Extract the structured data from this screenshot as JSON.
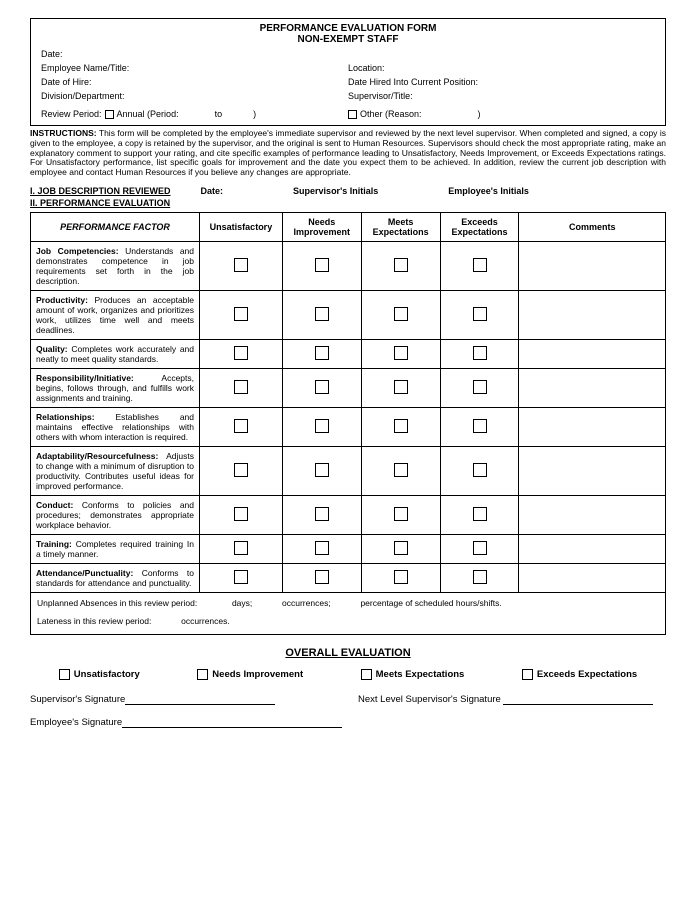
{
  "title1": "PERFORMANCE EVALUATION FORM",
  "title2": "NON-EXEMPT STAFF",
  "header": {
    "date": "Date:",
    "empName": "Employee Name/Title:",
    "location": "Location:",
    "dateHire": "Date of Hire:",
    "dateHiredPos": "Date Hired Into Current Position:",
    "division": "Division/Department:",
    "supervisor": "Supervisor/Title:",
    "reviewPeriod": "Review Period:",
    "annual": "Annual (Period:",
    "to": "to",
    "paren": ")",
    "other": "Other (Reason:"
  },
  "instrLabel": "INSTRUCTIONS:",
  "instrText": "This form will be completed by the employee's immediate supervisor and reviewed by the next level supervisor. When completed and signed, a copy is given to the employee, a copy is retained by the supervisor, and the original is sent to Human Resources. Supervisors should check the most appropriate rating, make an explanatory comment to support your rating, and cite specific examples of performance leading to Unsatisfactory, Needs Improvement, or Exceeds Expectations ratings. For Unsatisfactory performance, list specific goals for improvement and the date you expect them to be achieved. In addition, review the current job description with employee and contact Human Resources if you believe any changes are appropriate.",
  "sec1": "I.  JOB DESCRIPTION REVIEWED",
  "sec1Date": "Date:",
  "sec1Sup": "Supervisor's Initials",
  "sec1Emp": "Employee's Initials",
  "sec2": "II.  PERFORMANCE EVALUATION",
  "cols": {
    "factor": "PERFORMANCE FACTOR",
    "unsat": "Unsatisfactory",
    "needs": "Needs Improvement",
    "meets": "Meets Expectations",
    "exceeds": "Exceeds Expectations",
    "comments": "Comments"
  },
  "factors": [
    {
      "name": "Job Competencies:",
      "desc": " Understands and demonstrates competence in job requirements set forth in the job description."
    },
    {
      "name": "Productivity:",
      "desc": " Produces an acceptable amount of work, organizes and prioritizes work, utilizes time well and meets deadlines."
    },
    {
      "name": "Quality:",
      "desc": " Completes work accurately and neatly to meet quality standards."
    },
    {
      "name": "Responsibility/Initiative:",
      "desc": " Accepts, begins, follows through, and fulfills work assignments and training."
    },
    {
      "name": "Relationships:",
      "desc": " Establishes and maintains effective relationships with others with whom interaction is required."
    },
    {
      "name": "Adaptability/Resourcefulness:",
      "desc": " Adjusts to change with a minimum of disruption to productivity. Contributes useful ideas for improved performance."
    },
    {
      "name": "Conduct:",
      "desc": " Conforms to policies and procedures; demonstrates appropriate workplace behavior."
    },
    {
      "name": "Training:",
      "desc": " Completes required training In a timely manner."
    },
    {
      "name": "Attendance/Punctuality:",
      "desc": " Conforms to standards for attendance and punctuality."
    }
  ],
  "att1a": "Unplanned Absences in this review period:",
  "att1b": "days;",
  "att1c": "occurrences;",
  "att1d": "percentage of scheduled hours/shifts.",
  "att2a": "Lateness in this review period:",
  "att2b": "occurrences.",
  "overallTitle": "OVERALL EVALUATION",
  "overall": {
    "unsat": "Unsatisfactory",
    "needs": "Needs Improvement",
    "meets": "Meets Expectations",
    "exceeds": "Exceeds Expectations"
  },
  "sig": {
    "sup": "Supervisor's Signature",
    "next": "Next Level Supervisor's Signature",
    "emp": "Employee's Signature"
  }
}
